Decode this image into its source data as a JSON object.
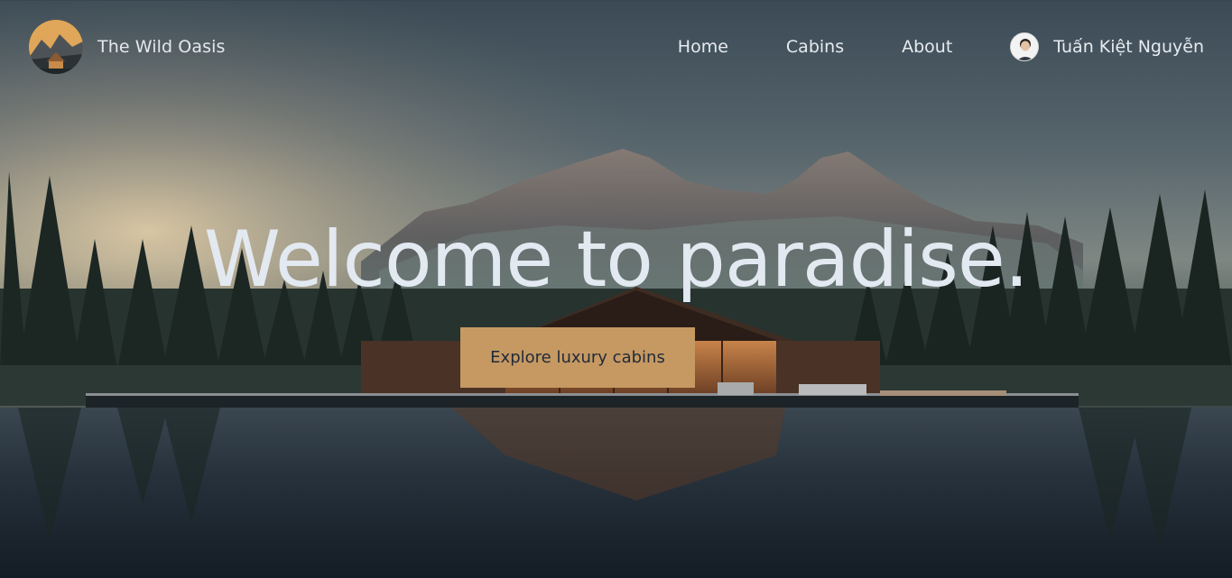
{
  "brand": {
    "name": "The Wild Oasis",
    "logo_icon": "mountain-cabin-logo-icon"
  },
  "nav": {
    "items": [
      {
        "label": "Home"
      },
      {
        "label": "Cabins"
      },
      {
        "label": "About"
      }
    ],
    "user": {
      "name": "Tuấn Kiệt Nguyễn",
      "avatar_icon": "user-avatar-icon"
    }
  },
  "hero": {
    "title": "Welcome to paradise.",
    "cta_label": "Explore luxury cabins"
  },
  "colors": {
    "accent": "#c69963",
    "text_light": "#e3e9f1",
    "dark_bg": "#141c25"
  }
}
